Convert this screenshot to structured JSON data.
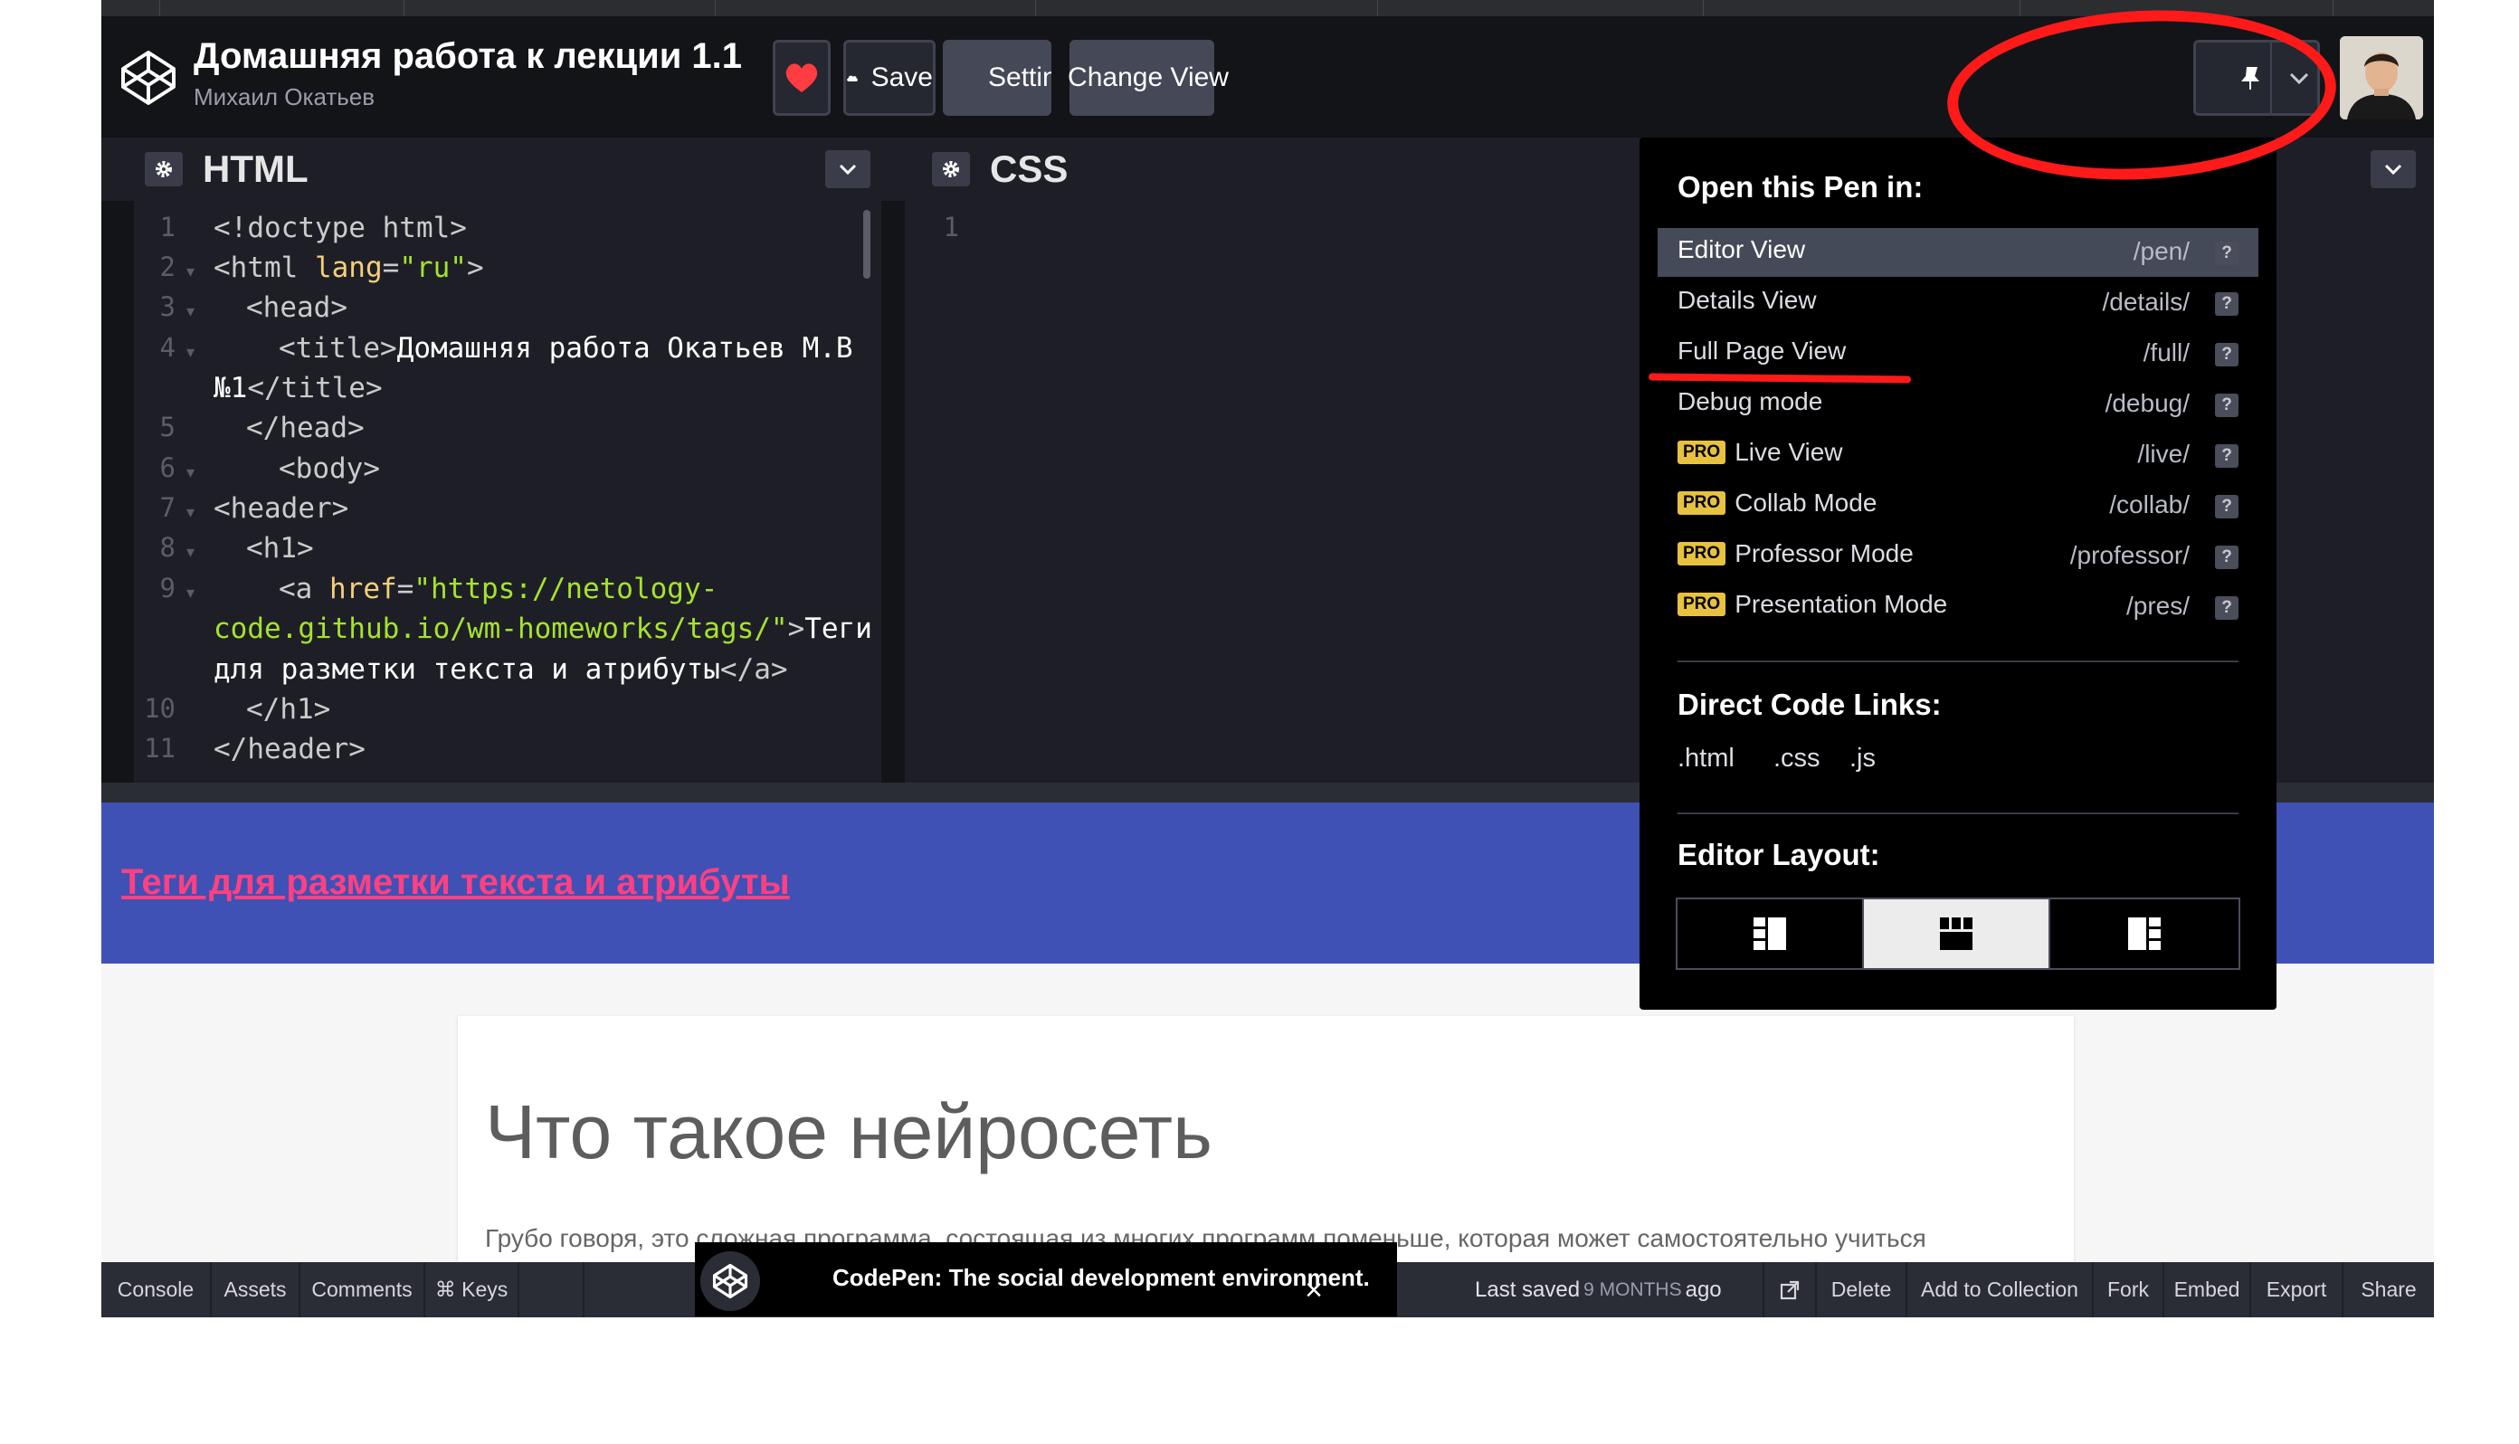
{
  "header": {
    "pen_title": "Домашняя работа к лекции 1.1",
    "author": "Михаил Окатьев",
    "buttons": {
      "save": "Save",
      "settings": "Settings",
      "change_view": "Change View"
    }
  },
  "editors": {
    "html": {
      "title": "HTML",
      "line_numbers": [
        "1",
        "2",
        "3",
        "4",
        "5",
        "6",
        "7",
        "8",
        "9",
        "10",
        "11"
      ],
      "code": {
        "l1": "<!doctype html>",
        "l2a": "<html ",
        "l2b": "lang",
        "l2c": "=",
        "l2d": "\"ru\"",
        "l2e": ">",
        "l3": "<head>",
        "l4a": "<title>",
        "l4b": "Домашняя работа Окатьев М.В",
        "l4c": "№1",
        "l4d": "</title>",
        "l5": "</head>",
        "l6": "<body>",
        "l7": "<header>",
        "l8": "<h1>",
        "l9a": "<a ",
        "l9b": "href",
        "l9c": "=",
        "l9d": "\"https://netology-",
        "l9e": "code.github.io/wm-homeworks/tags/\"",
        "l9f": ">",
        "l9g": "Теги",
        "l9h": "для разметки текста и атрибуты",
        "l9i": "</a>",
        "l10": "</h1>",
        "l11": "</header>"
      }
    },
    "css": {
      "title": "CSS",
      "line_numbers": [
        "1"
      ]
    }
  },
  "preview": {
    "header_link": "Теги для разметки текста и атрибуты",
    "article_title": "Что такое нейросеть",
    "article_text": "Грубо говоря, это сложная программа, состоящая из многих программ поменьше, которая может самостоятельно учиться"
  },
  "footer": {
    "console": "Console",
    "assets": "Assets",
    "comments": "Comments",
    "keys": "⌘ Keys",
    "last_saved_label": "Last saved",
    "last_saved_value": "9 MONTHS",
    "last_saved_suffix": "ago",
    "delete": "Delete",
    "add_to_collection": "Add to Collection",
    "fork": "Fork",
    "embed": "Embed",
    "export": "Export",
    "share": "Share"
  },
  "toast": {
    "text": "CodePen: The social development environment.",
    "close": "×"
  },
  "dropdown": {
    "open_heading": "Open this Pen in:",
    "views": [
      {
        "label": "Editor View",
        "path": "/pen/",
        "pro": false,
        "active": true
      },
      {
        "label": "Details View",
        "path": "/details/",
        "pro": false,
        "active": false
      },
      {
        "label": "Full Page View",
        "path": "/full/",
        "pro": false,
        "active": false
      },
      {
        "label": "Debug mode",
        "path": "/debug/",
        "pro": false,
        "active": false
      },
      {
        "label": "Live View",
        "path": "/live/",
        "pro": true,
        "active": false
      },
      {
        "label": "Collab Mode",
        "path": "/collab/",
        "pro": true,
        "active": false
      },
      {
        "label": "Professor Mode",
        "path": "/professor/",
        "pro": true,
        "active": false
      },
      {
        "label": "Presentation Mode",
        "path": "/pres/",
        "pro": true,
        "active": false
      }
    ],
    "pro_badge": "PRO",
    "help": "?",
    "direct_heading": "Direct Code Links:",
    "links": [
      ".html",
      ".css",
      ".js"
    ],
    "layout_heading": "Editor Layout:",
    "layout_selected": "middle"
  },
  "colors": {
    "app_bg": "#131417",
    "editor_bg": "#1e1f26",
    "preview_header": "#3f51b5",
    "preview_link": "#ff4081",
    "heart": "#ff3c41",
    "pro_badge": "#e7c23f",
    "annotation": "#ff1a1a"
  },
  "icons": [
    "codepen-logo-icon",
    "pencil-icon",
    "heart-icon",
    "cloud-icon",
    "gear-icon",
    "eye-window-icon",
    "pin-icon",
    "chevron-down-icon",
    "external-link-icon",
    "close-icon",
    "layout-left-icon",
    "layout-top-icon",
    "layout-right-icon"
  ]
}
